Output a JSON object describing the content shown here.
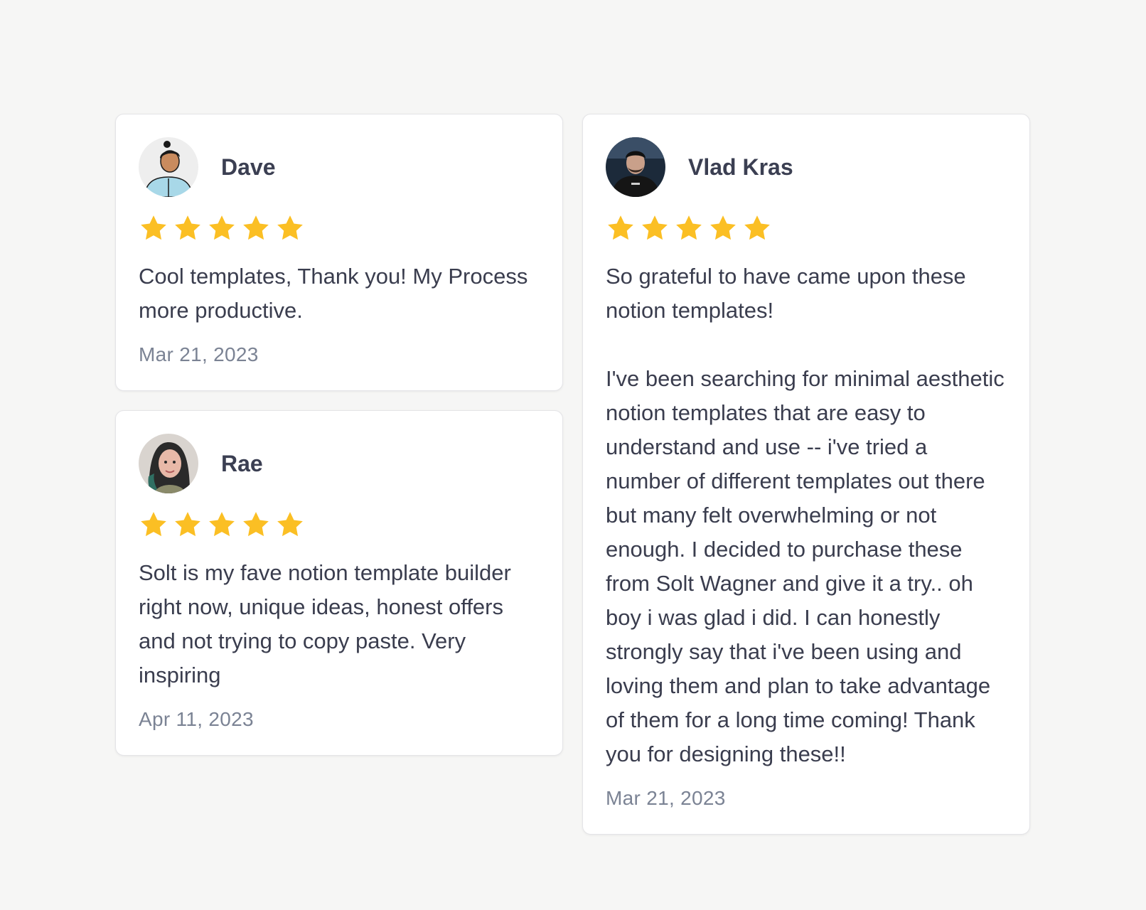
{
  "colors": {
    "star": "#fbbf24",
    "background": "#f6f6f5",
    "card": "#ffffff",
    "date": "#7b8394"
  },
  "reviews": [
    {
      "name": "Dave",
      "rating": 5,
      "text": "Cool templates, Thank you! My Process more productive.",
      "date": "Mar 21, 2023"
    },
    {
      "name": "Rae",
      "rating": 5,
      "text": "Solt is my fave notion template builder right now, unique ideas, honest offers and not trying to copy paste. Very inspiring",
      "date": "Apr 11, 2023"
    },
    {
      "name": "Vlad Kras",
      "rating": 5,
      "text": "So grateful to have came upon these notion templates!\n\nI've been searching for minimal aesthetic notion templates that are easy to understand and use -- i've tried a number of different templates out there but many felt overwhelming or not enough. I decided to purchase these from Solt Wagner and give it a try.. oh boy i was glad i did. I can honestly strongly say that i've been using and loving them and plan to take advantage of them for a long time coming! Thank you for designing these!!",
      "date": "Mar 21, 2023"
    }
  ]
}
